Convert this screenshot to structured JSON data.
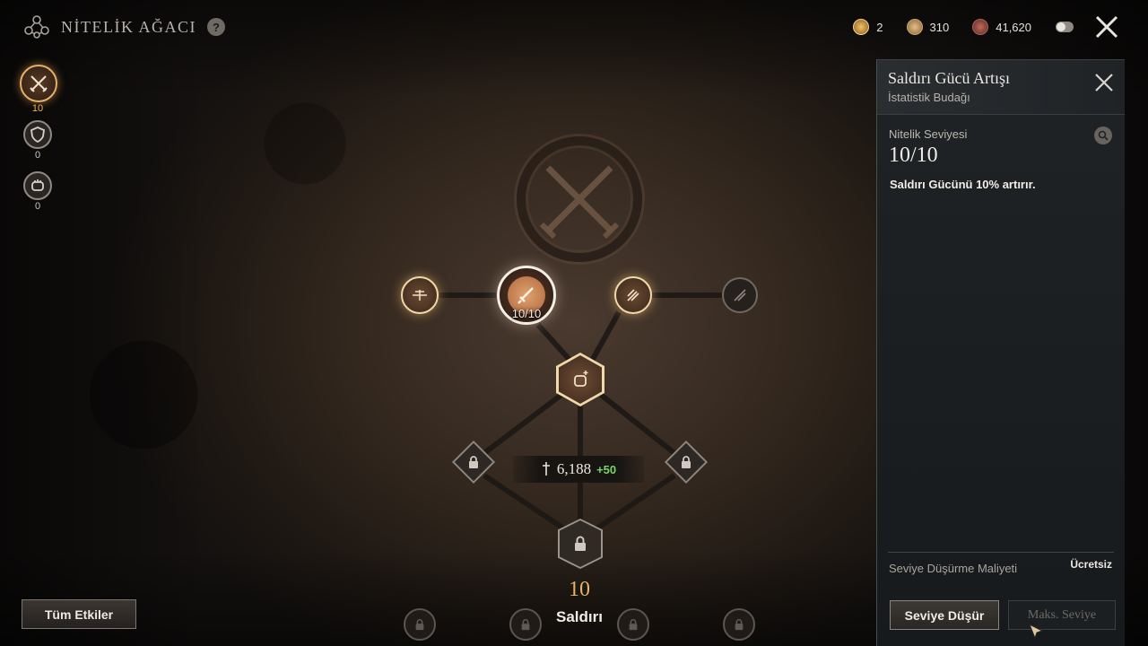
{
  "header": {
    "title": "NİTELİK AĞACI",
    "help_icon": "?",
    "currencies": [
      {
        "icon": "skill-point-icon",
        "value": "2",
        "color": "#d9a84a"
      },
      {
        "icon": "gold-coin-icon",
        "value": "310",
        "color": "#c9a160"
      },
      {
        "icon": "copper-coin-icon",
        "value": "41,620",
        "color": "#9a5a4a"
      }
    ],
    "toggle_icon": "toggle-icon",
    "close_icon": "close-icon"
  },
  "tree_tabs": [
    {
      "name": "crossed-swords-icon",
      "count": "10",
      "active": true
    },
    {
      "name": "shield-icon",
      "count": "0",
      "active": false
    },
    {
      "name": "fist-icon",
      "count": "0",
      "active": false
    }
  ],
  "tree": {
    "selected_node_level": "10/10",
    "power_value": "6,188",
    "power_bonus": "+50",
    "points_spent": "10",
    "branch_name": "Saldırı"
  },
  "all_effects_button": "Tüm Etkiler",
  "panel": {
    "title": "Saldırı Gücü Artışı",
    "subtitle": "İstatistik Budağı",
    "level_label": "Nitelik Seviyesi",
    "level_value": "10/10",
    "description": "Saldırı Gücünü 10% artırır.",
    "cost_label": "Seviye Düşürme Maliyeti",
    "cost_value": "Ücretsiz",
    "level_down_button": "Seviye Düşür",
    "max_level_button": "Maks. Seviye"
  }
}
